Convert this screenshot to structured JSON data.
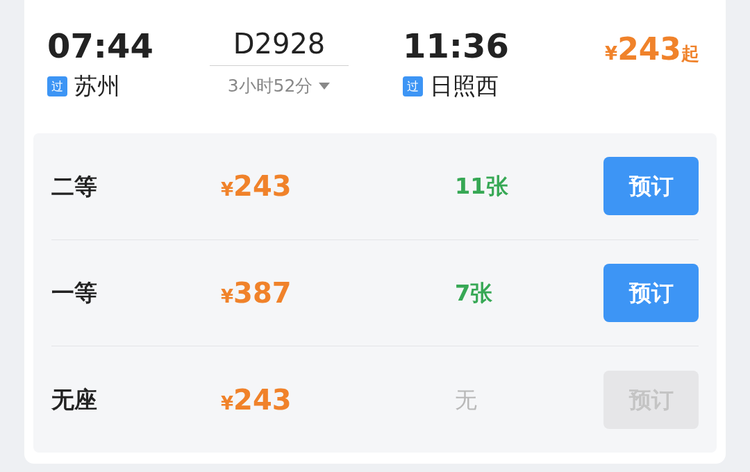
{
  "train": {
    "depart_time": "07:44",
    "depart_badge": "过",
    "depart_station": "苏州",
    "train_number": "D2928",
    "duration": "3小时52分",
    "arrive_time": "11:36",
    "arrive_badge": "过",
    "arrive_station": "日照西",
    "currency": "¥",
    "price": "243",
    "price_suffix": "起"
  },
  "seats": [
    {
      "name": "二等",
      "currency": "¥",
      "price": "243",
      "availability": "11张",
      "available": true,
      "button": "预订",
      "disabled": false
    },
    {
      "name": "一等",
      "currency": "¥",
      "price": "387",
      "availability": "7张",
      "available": true,
      "button": "预订",
      "disabled": false
    },
    {
      "name": "无座",
      "currency": "¥",
      "price": "243",
      "availability": "无",
      "available": false,
      "button": "预订",
      "disabled": true
    }
  ]
}
